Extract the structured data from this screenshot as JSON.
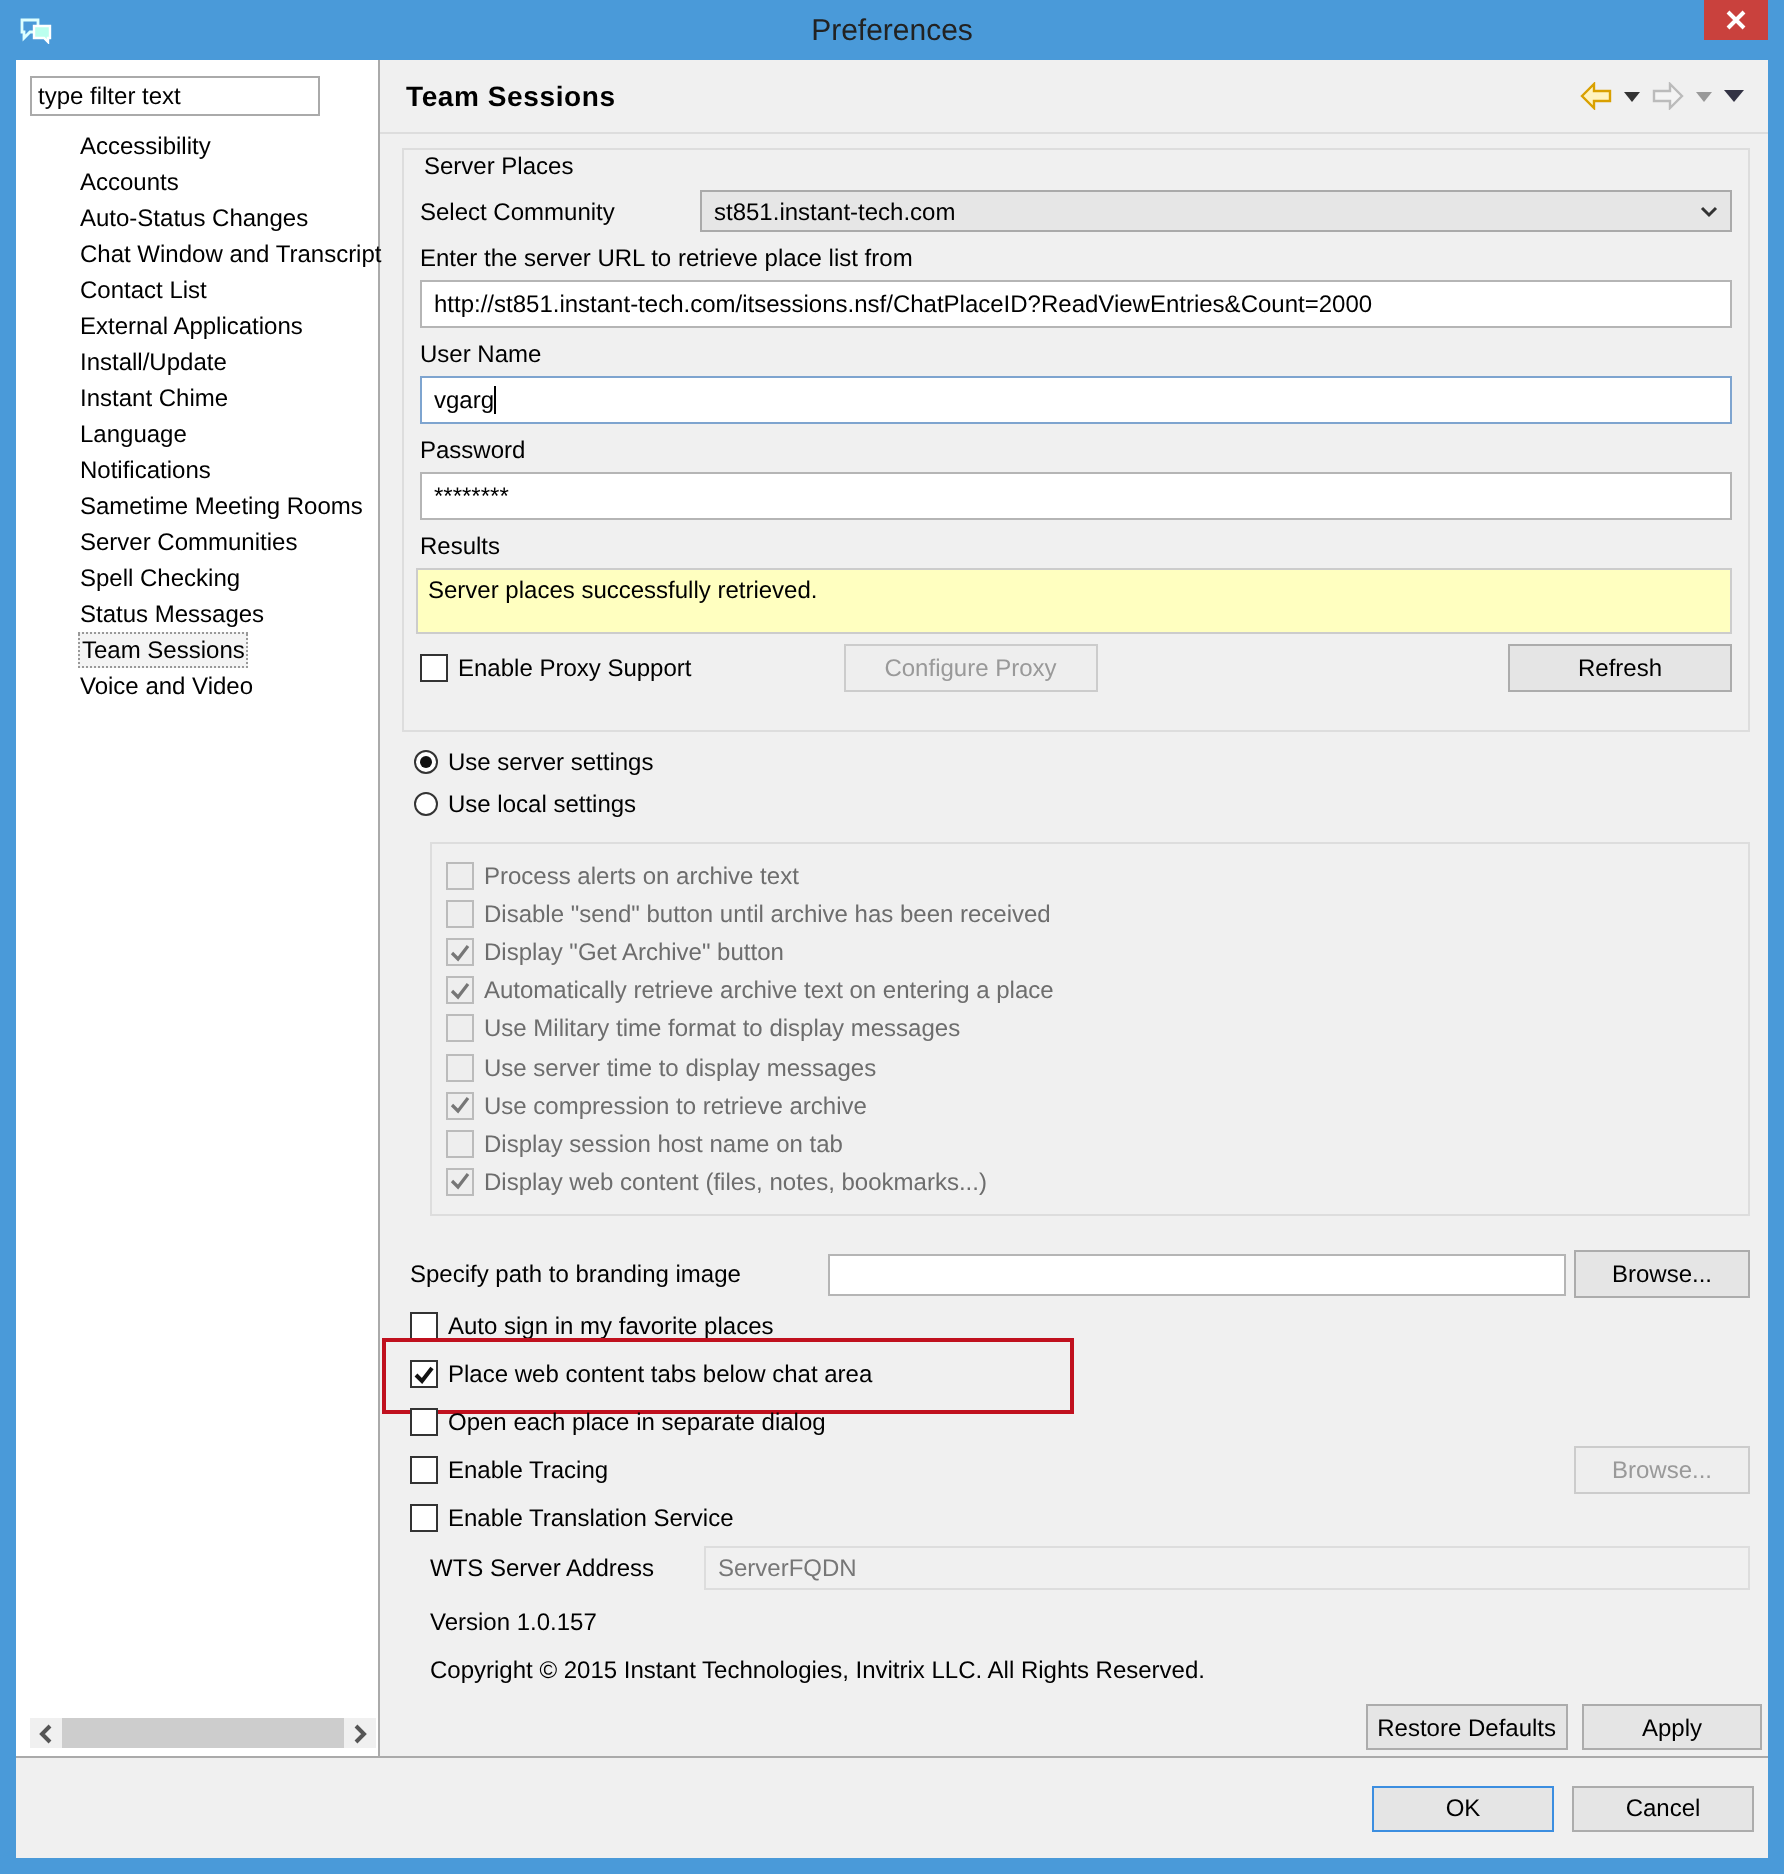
{
  "window": {
    "title": "Preferences"
  },
  "filter": {
    "placeholder": "type filter text"
  },
  "sidebar": {
    "items": [
      {
        "label": "Accessibility",
        "selected": false
      },
      {
        "label": "Accounts",
        "selected": false
      },
      {
        "label": "Auto-Status Changes",
        "selected": false
      },
      {
        "label": "Chat Window and Transcript",
        "selected": false
      },
      {
        "label": "Contact List",
        "selected": false
      },
      {
        "label": "External Applications",
        "selected": false
      },
      {
        "label": "Install/Update",
        "selected": false
      },
      {
        "label": "Instant Chime",
        "selected": false
      },
      {
        "label": "Language",
        "selected": false
      },
      {
        "label": "Notifications",
        "selected": false
      },
      {
        "label": "Sametime Meeting Rooms",
        "selected": false
      },
      {
        "label": "Server Communities",
        "selected": false
      },
      {
        "label": "Spell Checking",
        "selected": false
      },
      {
        "label": "Status Messages",
        "selected": false
      },
      {
        "label": "Team Sessions",
        "selected": true
      },
      {
        "label": "Voice and Video",
        "selected": false
      }
    ]
  },
  "page": {
    "title": "Team Sessions"
  },
  "server_places": {
    "title": "Server Places",
    "community_label": "Select Community",
    "community_value": "st851.instant-tech.com",
    "url_label": "Enter the server URL to retrieve place list from",
    "url_value": "http://st851.instant-tech.com/itsessions.nsf/ChatPlaceID?ReadViewEntries&Count=2000",
    "username_label": "User Name",
    "username_value": "vgarg",
    "password_label": "Password",
    "password_value": "********",
    "results_label": "Results",
    "results_text": "Server places successfully retrieved.",
    "proxy": {
      "label": "Enable Proxy Support",
      "checked": false
    },
    "configure_proxy": {
      "label": "Configure Proxy",
      "disabled": true
    },
    "refresh": {
      "label": "Refresh",
      "disabled": false
    }
  },
  "settings_mode": [
    {
      "label": "Use server settings",
      "selected": true
    },
    {
      "label": "Use local settings",
      "selected": false
    }
  ],
  "archive_options": [
    {
      "label": "Process alerts on archive text",
      "checked": false,
      "disabled": true
    },
    {
      "label": "Disable \"send\" button until archive has been received",
      "checked": false,
      "disabled": true
    },
    {
      "label": "Display \"Get Archive\" button",
      "checked": true,
      "disabled": true
    },
    {
      "label": "Automatically retrieve archive text on entering a place",
      "checked": true,
      "disabled": true
    },
    {
      "label": "Use Military time format to display messages",
      "checked": false,
      "disabled": true
    },
    {
      "label": "Use server time to display messages",
      "checked": false,
      "disabled": true
    },
    {
      "label": "Use compression to retrieve archive",
      "checked": true,
      "disabled": true
    },
    {
      "label": "Display session host name on tab",
      "checked": false,
      "disabled": true
    },
    {
      "label": "Display web content (files, notes, bookmarks...)",
      "checked": true,
      "disabled": true
    }
  ],
  "branding": {
    "label": "Specify path to branding image",
    "button": "Browse..."
  },
  "options": [
    {
      "label": "Auto sign in my favorite places",
      "checked": false,
      "highlighted": false
    },
    {
      "label": "Place web content tabs below chat area",
      "checked": true,
      "highlighted": true
    },
    {
      "label": "Open each place in separate dialog",
      "checked": false,
      "highlighted": false
    },
    {
      "label": "Enable Tracing",
      "checked": false,
      "highlighted": false,
      "button": {
        "label": "Browse...",
        "disabled": true
      }
    },
    {
      "label": "Enable Translation Service",
      "checked": false,
      "highlighted": false
    }
  ],
  "wts": {
    "label": "WTS Server Address",
    "value": "ServerFQDN",
    "disabled": true
  },
  "version": "Version 1.0.157",
  "copyright": "Copyright © 2015 Instant Technologies,  Invitrix LLC. All Rights Reserved.",
  "page_buttons": [
    {
      "label": "Restore Defaults"
    },
    {
      "label": "Apply"
    }
  ],
  "dialog_buttons": [
    {
      "label": "OK",
      "default": true
    },
    {
      "label": "Cancel",
      "default": false
    }
  ]
}
